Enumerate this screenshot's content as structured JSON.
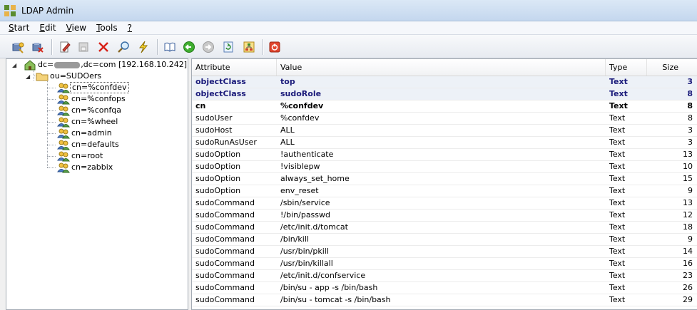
{
  "window": {
    "title": "LDAP Admin"
  },
  "menu": [
    {
      "access": "S",
      "rest": "tart"
    },
    {
      "access": "E",
      "rest": "dit"
    },
    {
      "access": "V",
      "rest": "iew"
    },
    {
      "access": "T",
      "rest": "ools"
    },
    {
      "access": "?",
      "rest": ""
    }
  ],
  "tree": {
    "root_prefix": "dc=",
    "root_suffix": ",dc=com [192.168.10.242]",
    "ou": "ou=SUDOers",
    "entries": [
      "cn=%confdev",
      "cn=%confops",
      "cn=%confqa",
      "cn=%wheel",
      "cn=admin",
      "cn=defaults",
      "cn=root",
      "cn=zabbix"
    ]
  },
  "grid": {
    "headers": {
      "attribute": "Attribute",
      "value": "Value",
      "type": "Type",
      "size": "Size"
    },
    "rows": [
      {
        "attribute": "objectClass",
        "value": "top",
        "type": "Text",
        "size": "3",
        "style": "oc"
      },
      {
        "attribute": "objectClass",
        "value": "sudoRole",
        "type": "Text",
        "size": "8",
        "style": "oc"
      },
      {
        "attribute": "cn",
        "value": "%confdev",
        "type": "Text",
        "size": "8",
        "style": "rdn"
      },
      {
        "attribute": "sudoUser",
        "value": "%confdev",
        "type": "Text",
        "size": "8",
        "style": ""
      },
      {
        "attribute": "sudoHost",
        "value": "ALL",
        "type": "Text",
        "size": "3",
        "style": ""
      },
      {
        "attribute": "sudoRunAsUser",
        "value": "ALL",
        "type": "Text",
        "size": "3",
        "style": ""
      },
      {
        "attribute": "sudoOption",
        "value": "!authenticate",
        "type": "Text",
        "size": "13",
        "style": ""
      },
      {
        "attribute": "sudoOption",
        "value": "!visiblepw",
        "type": "Text",
        "size": "10",
        "style": ""
      },
      {
        "attribute": "sudoOption",
        "value": "always_set_home",
        "type": "Text",
        "size": "15",
        "style": ""
      },
      {
        "attribute": "sudoOption",
        "value": "env_reset",
        "type": "Text",
        "size": "9",
        "style": ""
      },
      {
        "attribute": "sudoCommand",
        "value": "/sbin/service",
        "type": "Text",
        "size": "13",
        "style": ""
      },
      {
        "attribute": "sudoCommand",
        "value": "!/bin/passwd",
        "type": "Text",
        "size": "12",
        "style": ""
      },
      {
        "attribute": "sudoCommand",
        "value": "/etc/init.d/tomcat",
        "type": "Text",
        "size": "18",
        "style": ""
      },
      {
        "attribute": "sudoCommand",
        "value": "/bin/kill",
        "type": "Text",
        "size": "9",
        "style": ""
      },
      {
        "attribute": "sudoCommand",
        "value": "/usr/bin/pkill",
        "type": "Text",
        "size": "14",
        "style": ""
      },
      {
        "attribute": "sudoCommand",
        "value": "/usr/bin/killall",
        "type": "Text",
        "size": "16",
        "style": ""
      },
      {
        "attribute": "sudoCommand",
        "value": "/etc/init.d/confservice",
        "type": "Text",
        "size": "23",
        "style": ""
      },
      {
        "attribute": "sudoCommand",
        "value": "/bin/su - app -s /bin/bash",
        "type": "Text",
        "size": "26",
        "style": ""
      },
      {
        "attribute": "sudoCommand",
        "value": "/bin/su - tomcat -s /bin/bash",
        "type": "Text",
        "size": "29",
        "style": ""
      }
    ]
  }
}
